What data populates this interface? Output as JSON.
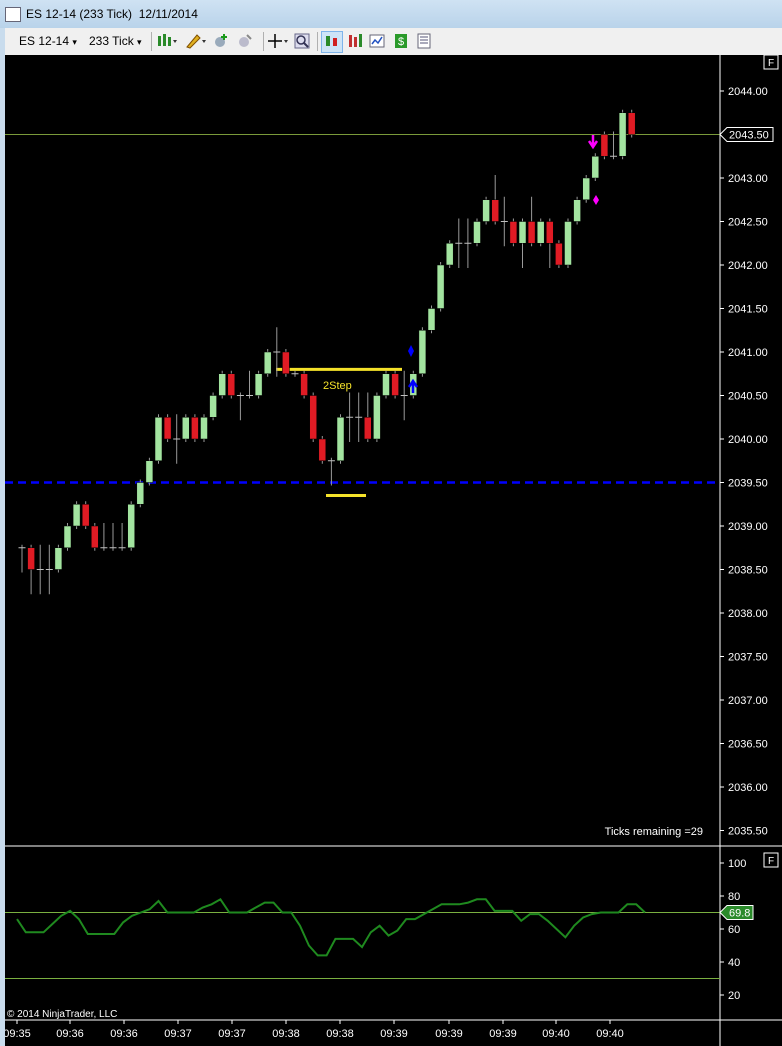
{
  "window": {
    "title": "ES 12-14 (233 Tick)  12/11/2014"
  },
  "toolbar": {
    "instrument": "ES 12-14",
    "interval": "233 Tick",
    "dropdown_glyph": "▾",
    "icons": [
      "bar-type-icon",
      "drawing-tool-icon",
      "add-indicator-icon",
      "strategy-icon",
      "crosshair-icon",
      "zoom-icon",
      "chart-trader-icon",
      "indicators-icon",
      "performance-icon",
      "dollar-icon",
      "properties-icon"
    ]
  },
  "price_panel": {
    "ylabels": [
      "2044.00",
      "2043.00",
      "2042.50",
      "2042.00",
      "2041.50",
      "2041.00",
      "2040.50",
      "2040.00",
      "2039.50",
      "2039.00",
      "2038.50",
      "2038.00",
      "2037.50",
      "2037.00",
      "2036.50",
      "2036.00",
      "2035.50"
    ],
    "last_price": "2043.50",
    "panel_flag": "F",
    "annotation": "2Step",
    "ticks_remaining": "Ticks remaining =29",
    "colors": {
      "up": "#a3e4a0",
      "down": "#e01b24",
      "yellow": "#f5e22a",
      "blue": "#0000ff",
      "magenta": "#ff00ff",
      "lastline": "#7a9a3a"
    }
  },
  "indicator_panel": {
    "ylabels": [
      "100",
      "80",
      "60",
      "40",
      "20"
    ],
    "last_value": "69.8",
    "panel_flag": "F",
    "line_color": "#1f8a1f"
  },
  "time_axis": {
    "labels": [
      "09:35",
      "09:36",
      "09:36",
      "09:37",
      "09:37",
      "09:38",
      "09:38",
      "09:39",
      "09:39",
      "09:39",
      "09:40",
      "09:40"
    ]
  },
  "copyright": "© 2014 NinjaTrader, LLC",
  "chart_data": {
    "type": "candlestick",
    "ylim": [
      2035.5,
      2044.25
    ],
    "last_price": 2043.5,
    "support_line": 2039.5,
    "bars": [
      {
        "o": 2038.75,
        "h": 2038.75,
        "l": 2038.5,
        "c": 2038.75
      },
      {
        "o": 2038.75,
        "h": 2038.75,
        "l": 2038.25,
        "c": 2038.5
      },
      {
        "o": 2038.5,
        "h": 2038.75,
        "l": 2038.25,
        "c": 2038.5
      },
      {
        "o": 2038.5,
        "h": 2038.75,
        "l": 2038.25,
        "c": 2038.5
      },
      {
        "o": 2038.5,
        "h": 2038.75,
        "l": 2038.5,
        "c": 2038.75
      },
      {
        "o": 2038.75,
        "h": 2039.0,
        "l": 2038.75,
        "c": 2039.0
      },
      {
        "o": 2039.0,
        "h": 2039.25,
        "l": 2039.0,
        "c": 2039.25
      },
      {
        "o": 2039.25,
        "h": 2039.25,
        "l": 2039.0,
        "c": 2039.0
      },
      {
        "o": 2039.0,
        "h": 2039.0,
        "l": 2038.75,
        "c": 2038.75
      },
      {
        "o": 2038.75,
        "h": 2039.0,
        "l": 2038.75,
        "c": 2038.75
      },
      {
        "o": 2038.75,
        "h": 2039.0,
        "l": 2038.75,
        "c": 2038.75
      },
      {
        "o": 2038.75,
        "h": 2039.0,
        "l": 2038.75,
        "c": 2038.75
      },
      {
        "o": 2038.75,
        "h": 2039.25,
        "l": 2038.75,
        "c": 2039.25
      },
      {
        "o": 2039.25,
        "h": 2039.5,
        "l": 2039.25,
        "c": 2039.5
      },
      {
        "o": 2039.5,
        "h": 2039.75,
        "l": 2039.5,
        "c": 2039.75
      },
      {
        "o": 2039.75,
        "h": 2040.25,
        "l": 2039.75,
        "c": 2040.25
      },
      {
        "o": 2040.25,
        "h": 2040.25,
        "l": 2040.0,
        "c": 2040.0
      },
      {
        "o": 2040.0,
        "h": 2040.25,
        "l": 2039.75,
        "c": 2040.0
      },
      {
        "o": 2040.0,
        "h": 2040.25,
        "l": 2040.0,
        "c": 2040.25
      },
      {
        "o": 2040.25,
        "h": 2040.25,
        "l": 2040.0,
        "c": 2040.0
      },
      {
        "o": 2040.0,
        "h": 2040.25,
        "l": 2040.0,
        "c": 2040.25
      },
      {
        "o": 2040.25,
        "h": 2040.5,
        "l": 2040.25,
        "c": 2040.5
      },
      {
        "o": 2040.5,
        "h": 2040.75,
        "l": 2040.5,
        "c": 2040.75
      },
      {
        "o": 2040.75,
        "h": 2040.75,
        "l": 2040.5,
        "c": 2040.5
      },
      {
        "o": 2040.5,
        "h": 2040.5,
        "l": 2040.25,
        "c": 2040.5
      },
      {
        "o": 2040.5,
        "h": 2040.75,
        "l": 2040.5,
        "c": 2040.5
      },
      {
        "o": 2040.5,
        "h": 2040.75,
        "l": 2040.5,
        "c": 2040.75
      },
      {
        "o": 2040.75,
        "h": 2041.0,
        "l": 2040.75,
        "c": 2041.0
      },
      {
        "o": 2041.0,
        "h": 2041.25,
        "l": 2040.75,
        "c": 2041.0
      },
      {
        "o": 2041.0,
        "h": 2041.0,
        "l": 2040.75,
        "c": 2040.75
      },
      {
        "o": 2040.75,
        "h": 2040.75,
        "l": 2040.75,
        "c": 2040.75
      },
      {
        "o": 2040.75,
        "h": 2040.75,
        "l": 2040.5,
        "c": 2040.5
      },
      {
        "o": 2040.5,
        "h": 2040.5,
        "l": 2040.0,
        "c": 2040.0
      },
      {
        "o": 2040.0,
        "h": 2040.0,
        "l": 2039.75,
        "c": 2039.75
      },
      {
        "o": 2039.75,
        "h": 2039.75,
        "l": 2039.5,
        "c": 2039.75
      },
      {
        "o": 2039.75,
        "h": 2040.25,
        "l": 2039.75,
        "c": 2040.25
      },
      {
        "o": 2040.25,
        "h": 2040.5,
        "l": 2040.0,
        "c": 2040.25
      },
      {
        "o": 2040.25,
        "h": 2040.5,
        "l": 2040.0,
        "c": 2040.25
      },
      {
        "o": 2040.25,
        "h": 2040.5,
        "l": 2040.0,
        "c": 2040.0
      },
      {
        "o": 2040.0,
        "h": 2040.5,
        "l": 2040.0,
        "c": 2040.5
      },
      {
        "o": 2040.5,
        "h": 2040.75,
        "l": 2040.5,
        "c": 2040.75
      },
      {
        "o": 2040.75,
        "h": 2040.75,
        "l": 2040.5,
        "c": 2040.5
      },
      {
        "o": 2040.5,
        "h": 2040.75,
        "l": 2040.25,
        "c": 2040.5
      },
      {
        "o": 2040.5,
        "h": 2040.75,
        "l": 2040.5,
        "c": 2040.75
      },
      {
        "o": 2040.75,
        "h": 2041.25,
        "l": 2040.75,
        "c": 2041.25
      },
      {
        "o": 2041.25,
        "h": 2041.5,
        "l": 2041.25,
        "c": 2041.5
      },
      {
        "o": 2041.5,
        "h": 2042.0,
        "l": 2041.5,
        "c": 2042.0
      },
      {
        "o": 2042.0,
        "h": 2042.25,
        "l": 2042.0,
        "c": 2042.25
      },
      {
        "o": 2042.25,
        "h": 2042.5,
        "l": 2042.0,
        "c": 2042.25
      },
      {
        "o": 2042.25,
        "h": 2042.5,
        "l": 2042.0,
        "c": 2042.25
      },
      {
        "o": 2042.25,
        "h": 2042.5,
        "l": 2042.25,
        "c": 2042.5
      },
      {
        "o": 2042.5,
        "h": 2042.75,
        "l": 2042.5,
        "c": 2042.75
      },
      {
        "o": 2042.75,
        "h": 2043.0,
        "l": 2042.5,
        "c": 2042.5
      },
      {
        "o": 2042.5,
        "h": 2042.75,
        "l": 2042.25,
        "c": 2042.5
      },
      {
        "o": 2042.5,
        "h": 2042.5,
        "l": 2042.25,
        "c": 2042.25
      },
      {
        "o": 2042.25,
        "h": 2042.5,
        "l": 2042.0,
        "c": 2042.5
      },
      {
        "o": 2042.5,
        "h": 2042.75,
        "l": 2042.25,
        "c": 2042.25
      },
      {
        "o": 2042.25,
        "h": 2042.5,
        "l": 2042.25,
        "c": 2042.5
      },
      {
        "o": 2042.5,
        "h": 2042.5,
        "l": 2042.0,
        "c": 2042.25
      },
      {
        "o": 2042.25,
        "h": 2042.25,
        "l": 2042.0,
        "c": 2042.0
      },
      {
        "o": 2042.0,
        "h": 2042.5,
        "l": 2042.0,
        "c": 2042.5
      },
      {
        "o": 2042.5,
        "h": 2042.75,
        "l": 2042.5,
        "c": 2042.75
      },
      {
        "o": 2042.75,
        "h": 2043.0,
        "l": 2042.75,
        "c": 2043.0
      },
      {
        "o": 2043.0,
        "h": 2043.25,
        "l": 2043.0,
        "c": 2043.25
      },
      {
        "o": 2043.5,
        "h": 2043.5,
        "l": 2043.25,
        "c": 2043.25
      },
      {
        "o": 2043.25,
        "h": 2043.5,
        "l": 2043.25,
        "c": 2043.25
      },
      {
        "o": 2043.25,
        "h": 2043.75,
        "l": 2043.25,
        "c": 2043.75
      },
      {
        "o": 2043.75,
        "h": 2043.75,
        "l": 2043.5,
        "c": 2043.5
      }
    ],
    "indicator": {
      "ylim": [
        10,
        110
      ],
      "upper_level": 70,
      "lower_level": 30,
      "values": [
        66,
        58,
        58,
        58,
        63,
        68,
        71,
        66,
        57,
        57,
        57,
        57,
        64,
        68,
        70,
        72,
        77,
        70,
        70,
        70,
        70,
        73,
        75,
        78,
        70,
        70,
        70,
        73,
        76,
        76,
        70,
        70,
        62,
        50,
        44,
        44,
        54,
        54,
        54,
        49,
        58,
        62,
        56,
        59,
        66,
        66,
        69,
        72,
        75,
        75,
        75,
        76,
        78,
        78,
        71,
        71,
        71,
        65,
        69,
        69,
        65,
        60,
        55,
        62,
        67,
        69,
        70,
        70,
        70,
        75,
        75,
        70
      ]
    }
  }
}
